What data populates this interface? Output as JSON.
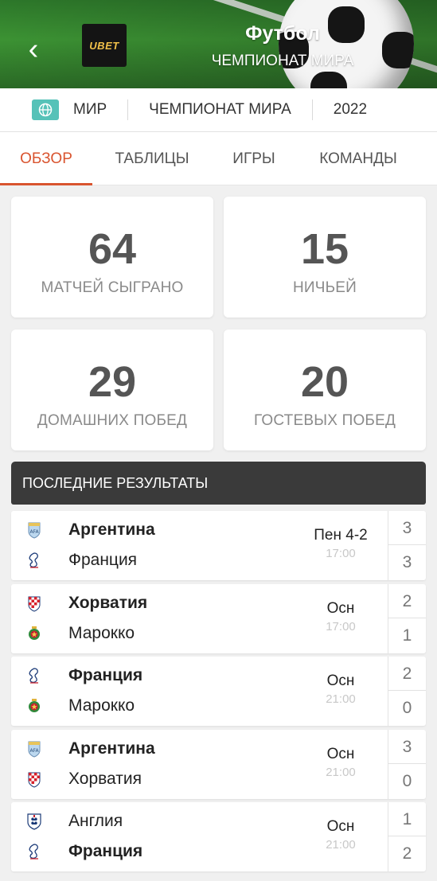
{
  "header": {
    "title": "Футбол",
    "subtitle": "ЧЕМПИОНАТ МИРА",
    "logo_text": "UBET",
    "back_glyph": "‹"
  },
  "breadcrumb": {
    "icon": "globe-icon",
    "items": [
      "МИР",
      "ЧЕМПИОНАТ МИРА",
      "2022"
    ]
  },
  "tabs": [
    {
      "label": "ОБЗОР",
      "active": true
    },
    {
      "label": "ТАБЛИЦЫ",
      "active": false
    },
    {
      "label": "ИГРЫ",
      "active": false
    },
    {
      "label": "КОМАНДЫ",
      "active": false
    }
  ],
  "stats": [
    {
      "value": "64",
      "label": "МАТЧЕЙ СЫГРАНО"
    },
    {
      "value": "15",
      "label": "НИЧЬЕЙ"
    },
    {
      "value": "29",
      "label": "ДОМАШНИХ ПОБЕД"
    },
    {
      "value": "20",
      "label": "ГОСТЕВЫХ ПОБЕД"
    }
  ],
  "results_title": "ПОСЛЕДНИЕ РЕЗУЛЬТАТЫ",
  "matches": [
    {
      "home": "Аргентина",
      "away": "Франция",
      "home_win": true,
      "away_win": false,
      "status": "Пен 4-2",
      "time": "17:00",
      "home_score": "3",
      "away_score": "3",
      "home_flag": "argentina-crest-icon",
      "away_flag": "france-crest-icon"
    },
    {
      "home": "Хорватия",
      "away": "Марокко",
      "home_win": true,
      "away_win": false,
      "status": "Осн",
      "time": "17:00",
      "home_score": "2",
      "away_score": "1",
      "home_flag": "croatia-crest-icon",
      "away_flag": "morocco-crest-icon"
    },
    {
      "home": "Франция",
      "away": "Марокко",
      "home_win": true,
      "away_win": false,
      "status": "Осн",
      "time": "21:00",
      "home_score": "2",
      "away_score": "0",
      "home_flag": "france-crest-icon",
      "away_flag": "morocco-crest-icon"
    },
    {
      "home": "Аргентина",
      "away": "Хорватия",
      "home_win": true,
      "away_win": false,
      "status": "Осн",
      "time": "21:00",
      "home_score": "3",
      "away_score": "0",
      "home_flag": "argentina-crest-icon",
      "away_flag": "croatia-crest-icon"
    },
    {
      "home": "Англия",
      "away": "Франция",
      "home_win": false,
      "away_win": true,
      "status": "Осн",
      "time": "21:00",
      "home_score": "1",
      "away_score": "2",
      "home_flag": "england-crest-icon",
      "away_flag": "france-crest-icon"
    }
  ],
  "colors": {
    "accent": "#d9542f",
    "results_header_bg": "#3a3a3a",
    "globe_bg": "#56c2b8"
  }
}
